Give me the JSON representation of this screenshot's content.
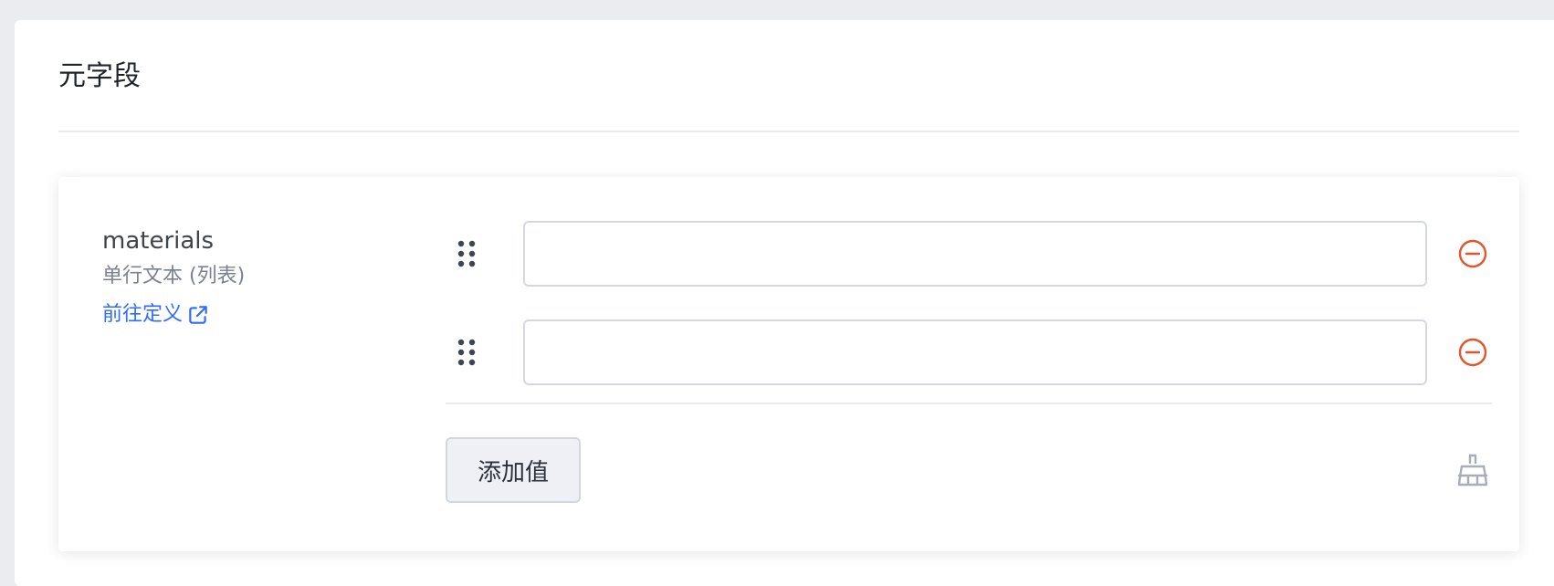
{
  "panel": {
    "title": "元字段"
  },
  "field": {
    "name": "materials",
    "type_label": "单行文本 (列表)",
    "definition_link": "前往定义",
    "values": [
      {
        "value": "",
        "placeholder": ""
      },
      {
        "value": "",
        "placeholder": ""
      }
    ],
    "add_value_label": "添加值"
  },
  "colors": {
    "background": "#ebecf0",
    "link": "#2f6bff",
    "remove": "#e5542b",
    "muted_icon": "#a9adb7",
    "handle": "#3e4450"
  },
  "icons": {
    "link": "external-link-icon",
    "drag": "drag-handle-icon",
    "remove": "minus-circle-icon",
    "clear": "broom-icon"
  }
}
